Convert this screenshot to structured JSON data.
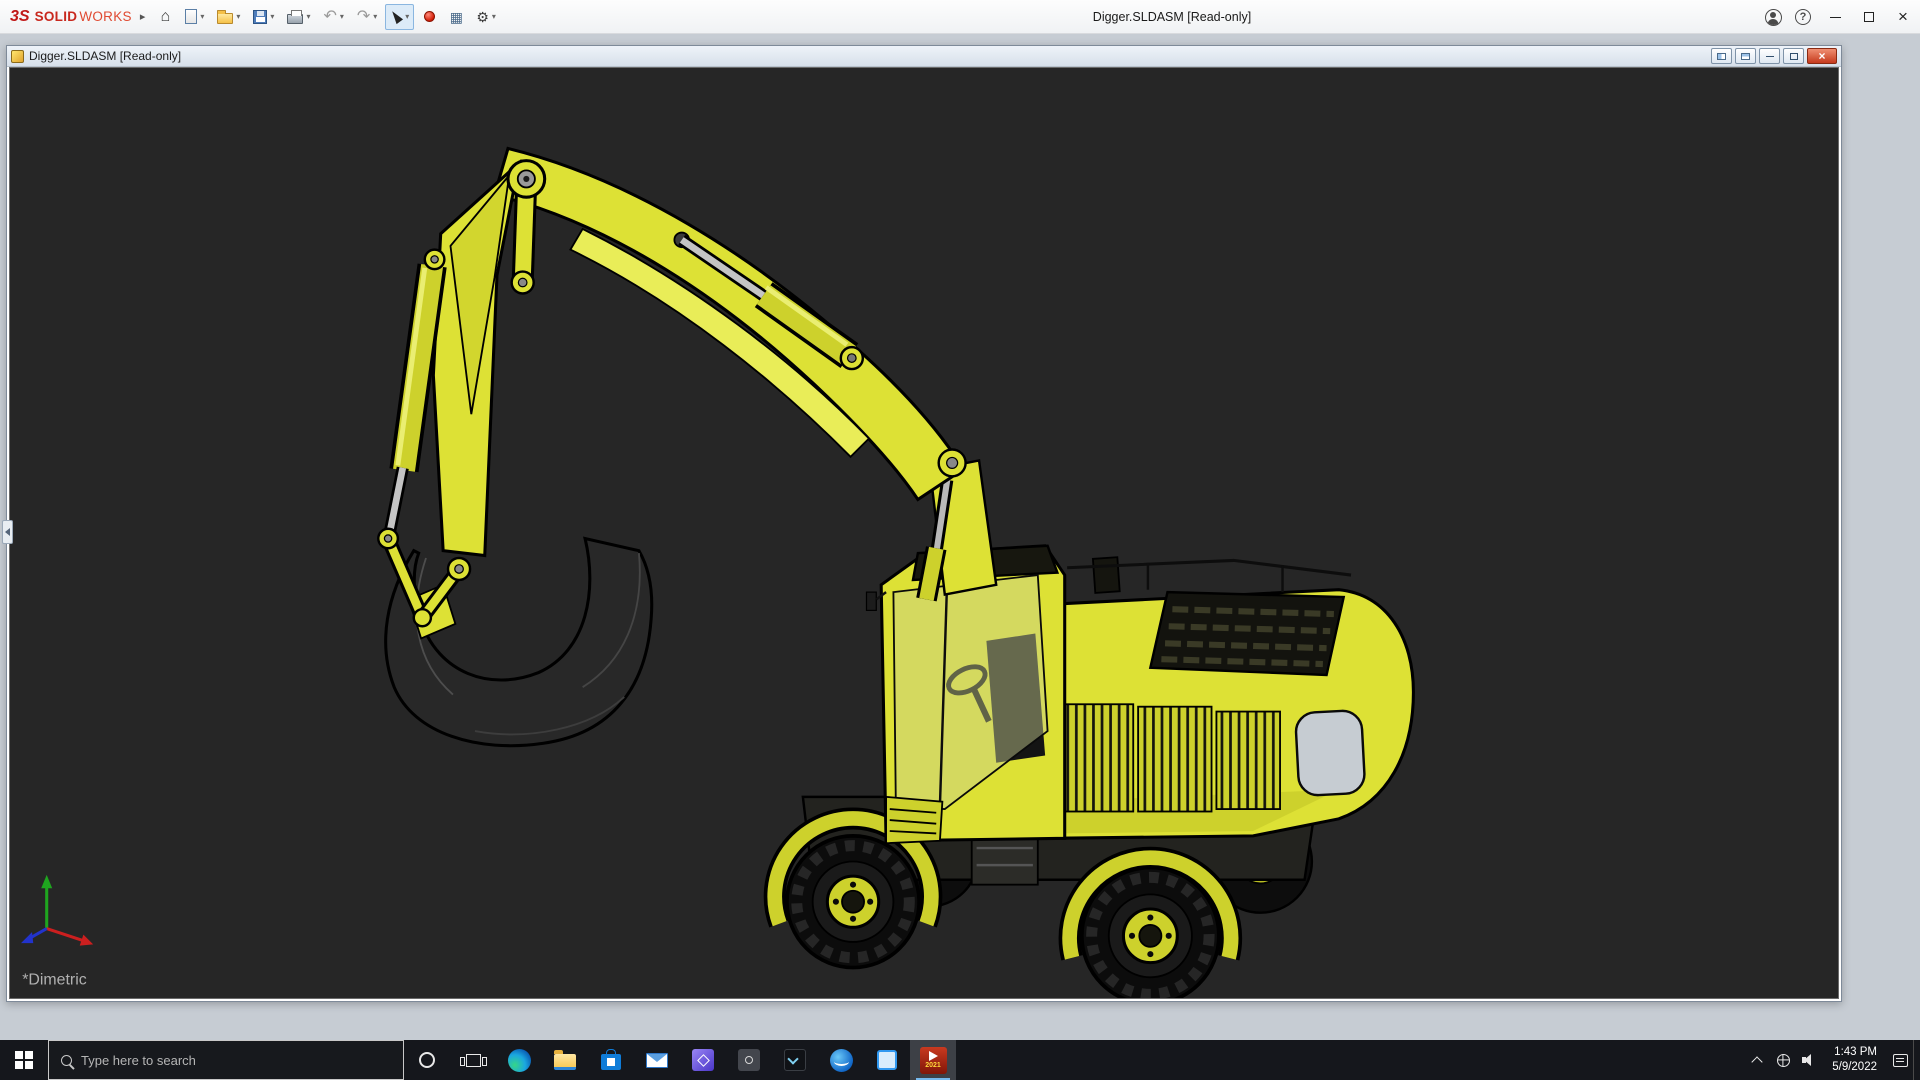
{
  "app": {
    "brand": {
      "mark": "3S",
      "bold": "SOLID",
      "light": "WORKS"
    },
    "title": "Digger.SLDASM [Read-only]",
    "ui": {
      "expander": "▸",
      "caret": "▾",
      "home": "⌂",
      "undo": "↶",
      "redo": "↷",
      "properties": "▦",
      "settings": "⚙",
      "help": "?",
      "close": "×"
    }
  },
  "document": {
    "title": "Digger.SLDASM [Read-only]",
    "view_label": "*Dimetric"
  },
  "taskbar": {
    "search_placeholder": "Type here to search",
    "sw_badge": "2021",
    "clock": {
      "time": "1:43 PM",
      "date": "5/9/2022"
    }
  },
  "colors": {
    "excavator_yellow": "#dde135",
    "viewport_bg": "#262626",
    "taskbar_bg": "#15171c",
    "close_red": "#c63a1d"
  }
}
